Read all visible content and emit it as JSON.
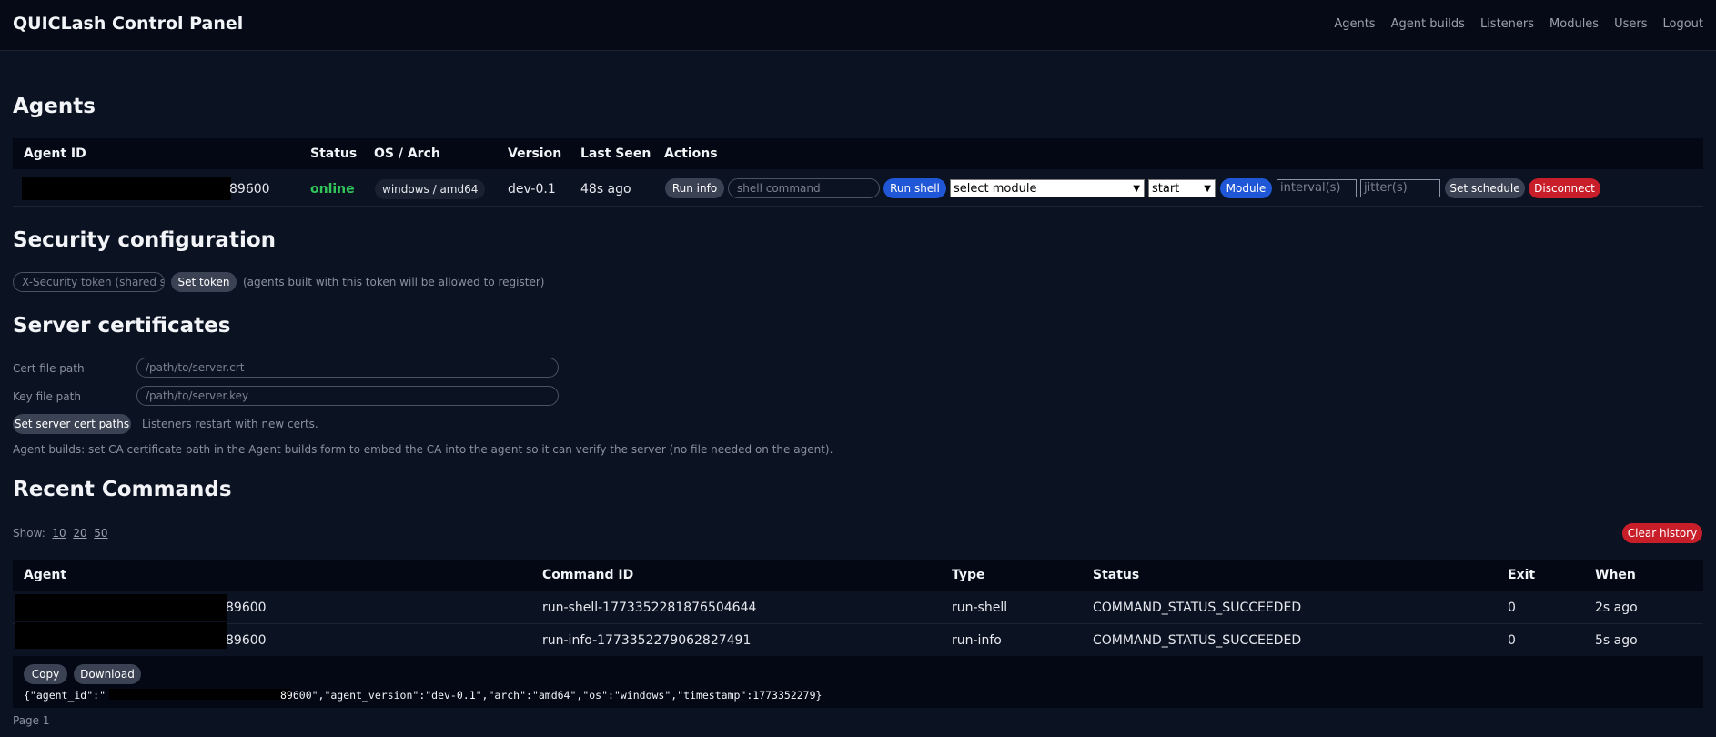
{
  "app": {
    "title": "QUICLash Control Panel"
  },
  "nav": [
    "Agents",
    "Agent builds",
    "Listeners",
    "Modules",
    "Users",
    "Logout"
  ],
  "agents": {
    "heading": "Agents",
    "columns": [
      "Agent ID",
      "Status",
      "OS / Arch",
      "Version",
      "Last Seen",
      "Actions"
    ],
    "row": {
      "id_suffix": "89600",
      "status": "online",
      "os_arch": "windows / amd64",
      "version": "dev-0.1",
      "last_seen": "48s ago"
    },
    "actions": {
      "run_info": "Run info",
      "shell_placeholder": "shell command",
      "run_shell": "Run shell",
      "module_select": "select module",
      "mode_select": "start",
      "module_button": "Module",
      "interval_placeholder": "interval(s)",
      "jitter_placeholder": "jitter(s)",
      "set_schedule": "Set schedule",
      "disconnect": "Disconnect"
    }
  },
  "security": {
    "heading": "Security configuration",
    "token_placeholder": "X-Security token (shared se",
    "set_token": "Set token",
    "hint": "(agents built with this token will be allowed to register)"
  },
  "certs": {
    "heading": "Server certificates",
    "cert_label": "Cert file path",
    "cert_placeholder": "/path/to/server.crt",
    "key_label": "Key file path",
    "key_placeholder": "/path/to/server.key",
    "set_button": "Set server cert paths",
    "restart_note": "Listeners restart with new certs.",
    "builds_note": "Agent builds: set CA certificate path in the Agent builds form to embed the CA into the agent so it can verify the server (no file needed on the agent)."
  },
  "commands": {
    "heading": "Recent Commands",
    "show_label": "Show:",
    "show_options": [
      "10",
      "20",
      "50"
    ],
    "clear_history": "Clear history",
    "columns": [
      "Agent",
      "Command ID",
      "Type",
      "Status",
      "Exit",
      "When"
    ],
    "rows": [
      {
        "agent_suffix": "89600",
        "command_id": "run-shell-1773352281876504644",
        "type": "run-shell",
        "status": "COMMAND_STATUS_SUCCEEDED",
        "exit": "0",
        "when": "2s ago"
      },
      {
        "agent_suffix": "89600",
        "command_id": "run-info-1773352279062827491",
        "type": "run-info",
        "status": "COMMAND_STATUS_SUCCEEDED",
        "exit": "0",
        "when": "5s ago"
      }
    ],
    "copy": "Copy",
    "download": "Download",
    "output_prefix": "{\"agent_id\":\"",
    "output_suffix": "89600\",\"agent_version\":\"dev-0.1\",\"arch\":\"amd64\",\"os\":\"windows\",\"timestamp\":1773352279}",
    "page": "Page 1"
  },
  "colors": {
    "bg": "#0b1221",
    "bar": "#030814",
    "blue": "#1f57d6",
    "red": "#c81e2a",
    "online": "#31c55a"
  }
}
